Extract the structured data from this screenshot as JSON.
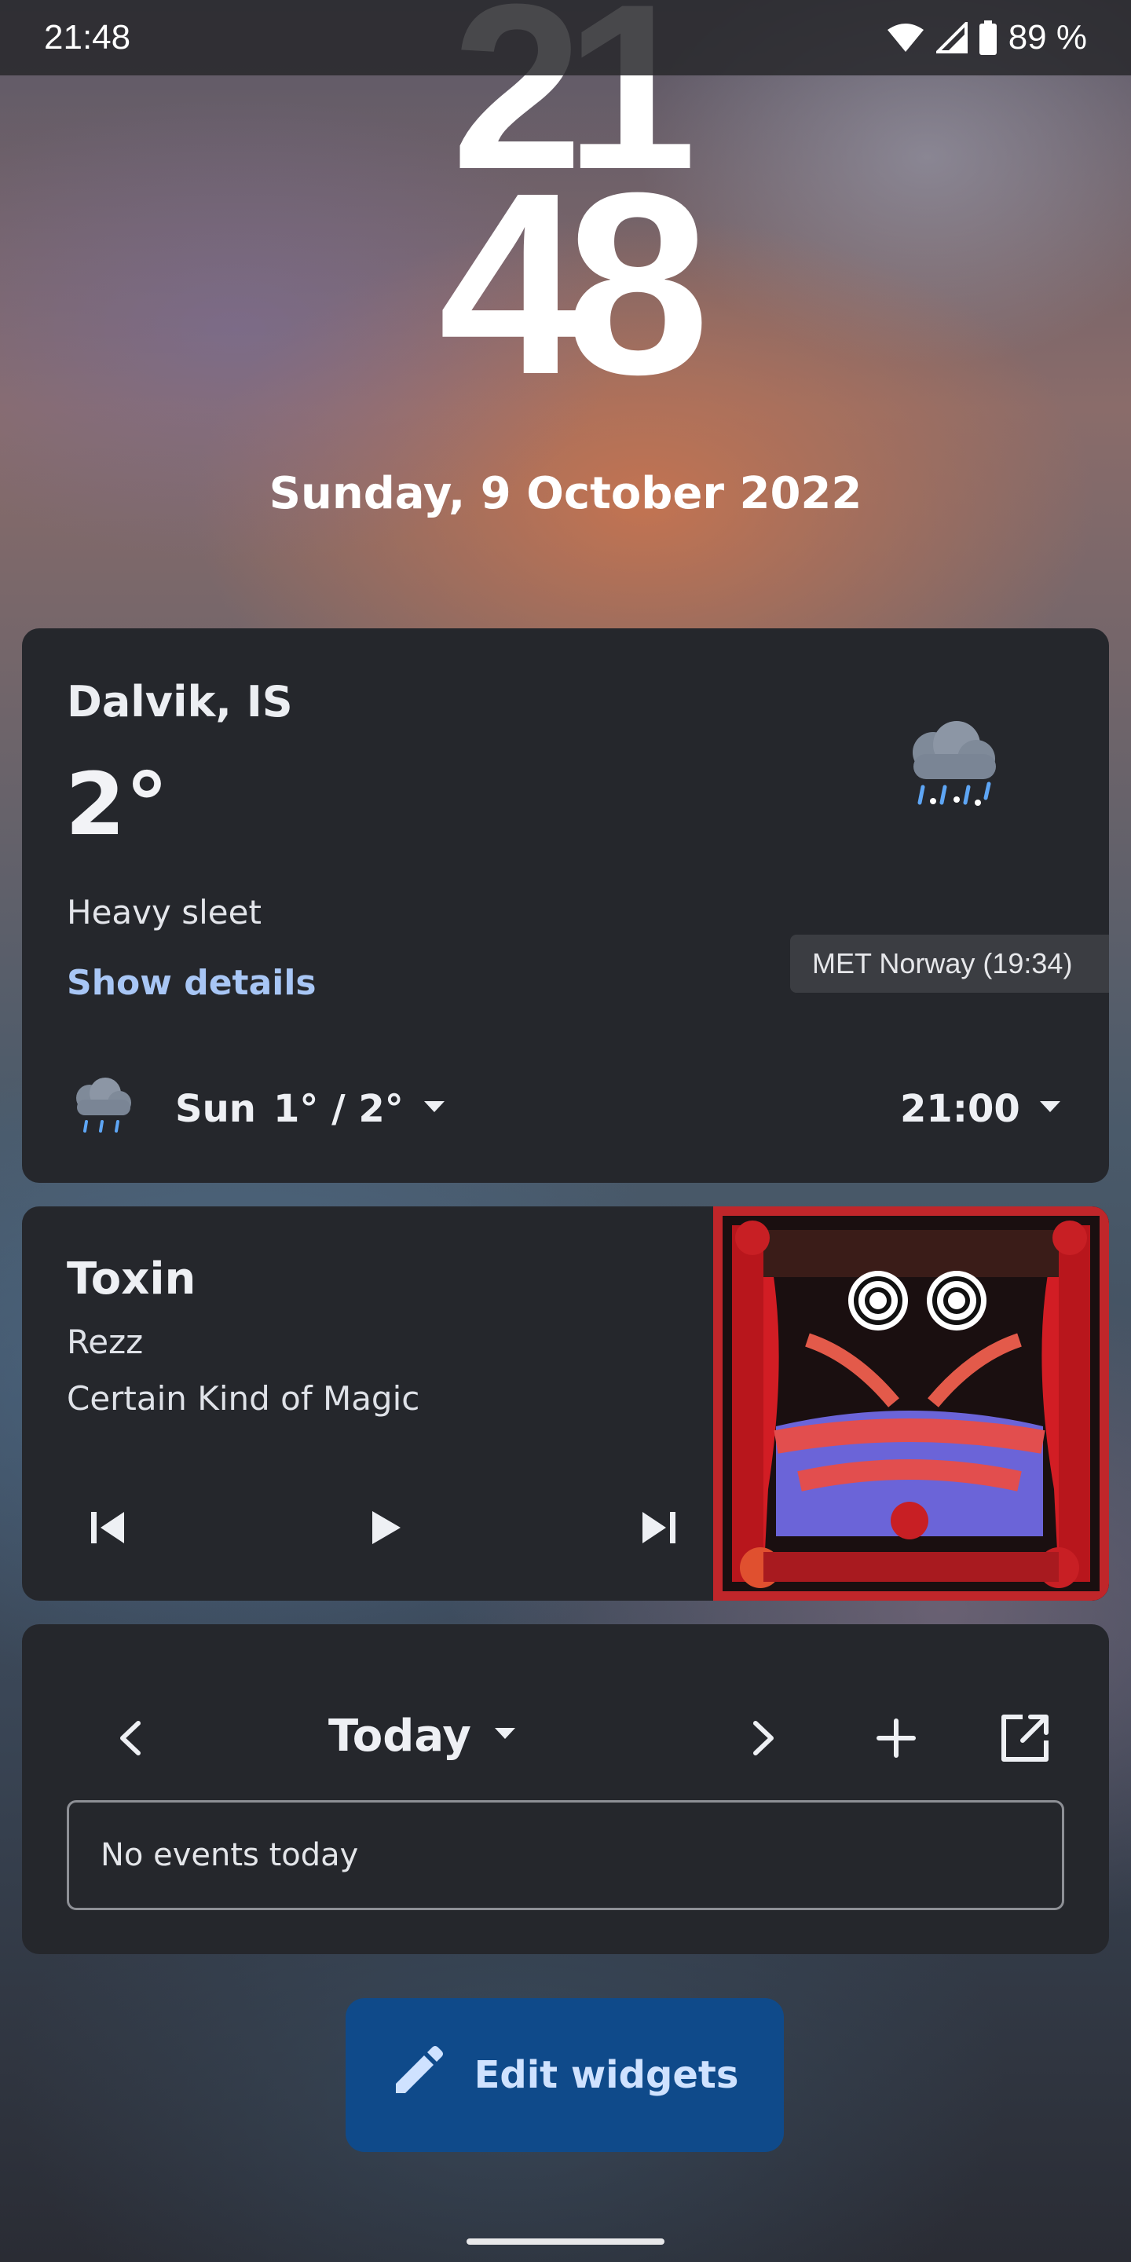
{
  "status_bar": {
    "time": "21:48",
    "battery": "89 %",
    "icons": [
      "wifi-icon",
      "signal-icon",
      "battery-icon"
    ]
  },
  "clock": {
    "hours": "21",
    "minutes": "48"
  },
  "date": "Sunday, 9 October 2022",
  "weather": {
    "location": "Dalvik, IS",
    "temperature": "2°",
    "condition": "Heavy sleet",
    "details_link": "Show details",
    "source": "MET Norway (19:34)",
    "forecast": {
      "day": "Sun",
      "range": "1° / 2°",
      "time": "21:00"
    },
    "icon": "sleet-cloud-icon"
  },
  "music": {
    "title": "Toxin",
    "artist": "Rezz",
    "album": "Certain Kind of Magic",
    "controls": [
      "skip-previous-icon",
      "play-icon",
      "skip-next-icon"
    ]
  },
  "calendar": {
    "title": "Today",
    "empty_text": "No events today"
  },
  "edit_button": {
    "label": "Edit widgets"
  },
  "colors": {
    "card": "#25272c",
    "link": "#a8c6f5",
    "button": "#0f4a8a"
  }
}
